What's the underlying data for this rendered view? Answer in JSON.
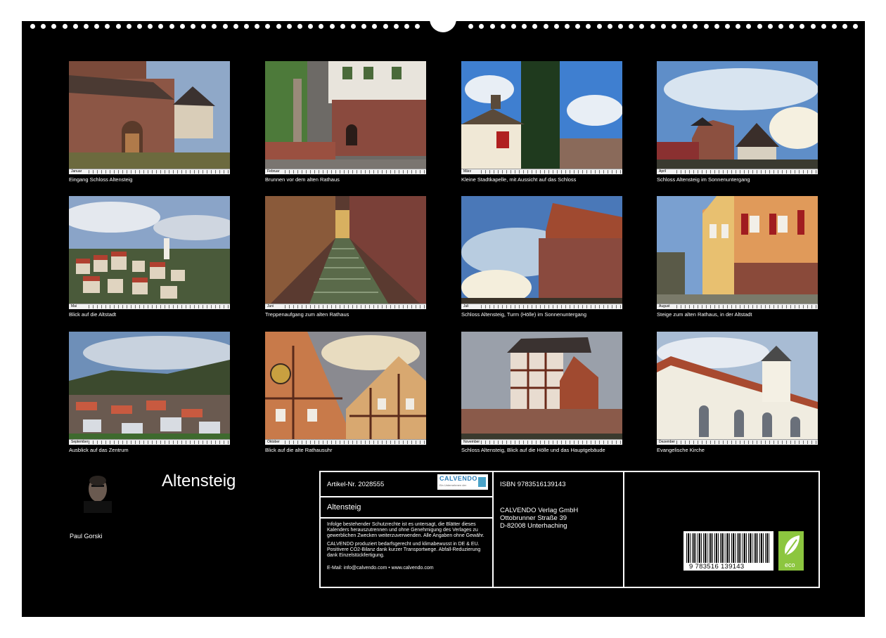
{
  "calendar": {
    "title": "Altensteig",
    "author": "Paul Gorski",
    "tiles": [
      {
        "month": "Januar",
        "caption": "Eingang Schloss Altensteig"
      },
      {
        "month": "Februar",
        "caption": "Brunnen vor dem alten Rathaus"
      },
      {
        "month": "März",
        "caption": "Kleine Stadtkapelle, mit Aussicht auf das Schloss"
      },
      {
        "month": "April",
        "caption": "Schloss Altensteig im Sonnenuntergang"
      },
      {
        "month": "Mai",
        "caption": "Blick auf die Altstadt"
      },
      {
        "month": "Juni",
        "caption": "Treppenaufgang zum alten Rathaus"
      },
      {
        "month": "Juli",
        "caption": "Schloss Altensteig, Turm (Hölle) im Sonnenuntergang"
      },
      {
        "month": "August",
        "caption": "Steige zum alten Rathaus, in der Altstadt"
      },
      {
        "month": "September",
        "caption": "Ausblick auf das Zentrum"
      },
      {
        "month": "Oktober",
        "caption": "Blick auf die alte Rathausuhr"
      },
      {
        "month": "November",
        "caption": "Schloss Altensteig, Blick auf die Hölle und das Hauptgebäude"
      },
      {
        "month": "Dezember",
        "caption": "Evangelische Kirche"
      }
    ]
  },
  "info": {
    "artikel": "Artikel-Nr. 2028555",
    "logo_text": "CALVENDO",
    "logo_sub": "Ein Unternehmen der",
    "box_title": "Altensteig",
    "legal1": "Infolge bestehender Schutzrechte ist es untersagt, die Blätter dieses Kalenders herauszutrennen und ohne Genehmigung des Verlages zu gewerblichen Zwecken weiterzuverwenden. Alle Angaben ohne Gewähr.",
    "legal2": "CALVENDO produziert bedarfsgerecht und klimabewusst in DE & EU. Positivere CO2-Bilanz dank kurzer Transportwege. Abfall-Reduzierung dank Einzelstückfertigung.",
    "contact": "E-Mail: info@calvendo.com • www.calvendo.com",
    "isbn": "ISBN 9783516139143",
    "publisher_name": "CALVENDO Verlag GmbH",
    "publisher_street": "Ottobrunner Straße 39",
    "publisher_city": "D-82008 Unterhaching",
    "barcode_digits": "9 783516 139143",
    "eco_label": "eco"
  },
  "colors": {
    "background": "#000000",
    "text": "#ffffff",
    "eco": "#8cc63f",
    "logo": "#2c7fb8"
  }
}
